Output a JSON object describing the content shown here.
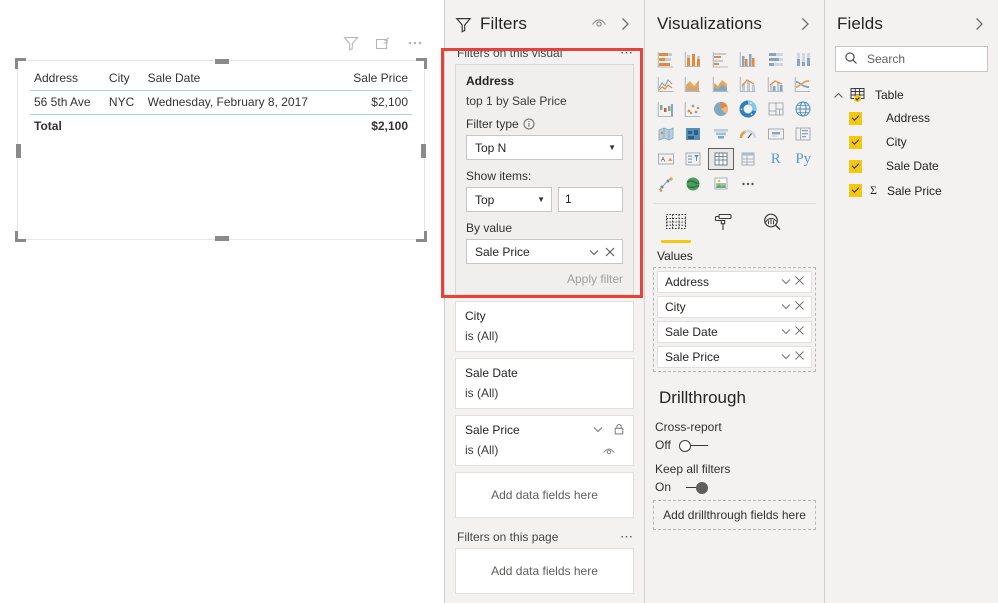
{
  "canvas": {
    "visual_header_icons": [
      "filter-icon",
      "focus-mode-icon",
      "more-options-icon"
    ],
    "table": {
      "columns": [
        "Address",
        "City",
        "Sale Date",
        "Sale Price"
      ],
      "rows": [
        [
          "56 5th Ave",
          "NYC",
          "Wednesday, February 8, 2017",
          "$2,100"
        ]
      ],
      "total_label": "Total",
      "total_value": "$2,100"
    }
  },
  "filters": {
    "title": "Filters",
    "eye_icon": "eye-icon",
    "expand_icon": "chevron-right-icon",
    "visual_section_label": "Filters on this visual",
    "page_section_label": "Filters on this page",
    "more_icon": "ellipsis-icon",
    "active_card": {
      "field": "Address",
      "summary": "top 1 by Sale Price",
      "filter_type_label": "Filter type",
      "info_icon": "info-icon",
      "filter_type_value": "Top N",
      "show_items_label": "Show items:",
      "show_items_direction": "Top",
      "show_items_count": "1",
      "by_value_label": "By value",
      "by_value_field": "Sale Price",
      "apply_label": "Apply filter"
    },
    "cards": [
      {
        "field": "City",
        "value": "is (All)",
        "icons": []
      },
      {
        "field": "Sale Date",
        "value": "is (All)",
        "icons": []
      },
      {
        "field": "Sale Price",
        "value": "is (All)",
        "icons": [
          "chevron-down-icon",
          "lock-icon",
          "eye-icon"
        ]
      }
    ],
    "add_fields_visual": "Add data fields here",
    "add_fields_page": "Add data fields here"
  },
  "visualizations": {
    "title": "Visualizations",
    "expand_icon": "chevron-right-icon",
    "gallery": [
      "stacked-bar-chart-icon",
      "stacked-column-chart-icon",
      "clustered-bar-chart-icon",
      "clustered-column-chart-icon",
      "100-stacked-bar-chart-icon",
      "100-stacked-column-chart-icon",
      "line-chart-icon",
      "area-chart-icon",
      "stacked-area-chart-icon",
      "line-stacked-column-chart-icon",
      "line-clustered-column-chart-icon",
      "ribbon-chart-icon",
      "waterfall-chart-icon",
      "scatter-chart-icon",
      "pie-chart-icon",
      "donut-chart-icon",
      "treemap-icon",
      "map-icon",
      "filled-map-icon",
      "shape-map-icon",
      "funnel-chart-icon",
      "gauge-chart-icon",
      "card-icon",
      "multi-row-card-icon",
      "kpi-icon",
      "slicer-icon",
      "table-icon",
      "matrix-icon",
      "r-script-visual-icon",
      "python-visual-icon",
      "key-influencers-icon",
      "arcgis-map-icon",
      "paginated-report-icon",
      "more-visuals-icon"
    ],
    "selected_visual": "table-icon",
    "tabs": [
      {
        "name": "fields-tab",
        "icon": "fields-icon",
        "active": true
      },
      {
        "name": "format-tab",
        "icon": "paint-roller-icon",
        "active": false
      },
      {
        "name": "analytics-tab",
        "icon": "magnifier-chart-icon",
        "active": false
      }
    ],
    "well_title": "Values",
    "well_items": [
      "Address",
      "City",
      "Sale Date",
      "Sale Price"
    ],
    "drillthrough": {
      "title": "Drillthrough",
      "cross_report_label": "Cross-report",
      "cross_report_state": "Off",
      "keep_all_filters_label": "Keep all filters",
      "keep_all_filters_state": "On",
      "placeholder": "Add drillthrough fields here"
    }
  },
  "fields": {
    "title": "Fields",
    "expand_icon": "chevron-right-icon",
    "search_placeholder": "Search",
    "search_value": "",
    "search_icon": "search-icon",
    "table_name": "Table",
    "items": [
      {
        "label": "Address",
        "checked": true,
        "measure": false
      },
      {
        "label": "City",
        "checked": true,
        "measure": false
      },
      {
        "label": "Sale Date",
        "checked": true,
        "measure": false
      },
      {
        "label": "Sale Price",
        "checked": true,
        "measure": true,
        "sigma": "Σ"
      }
    ]
  },
  "colors": {
    "accent_yellow": "#f2c811",
    "highlight_red": "#e8413a",
    "pane_bg": "#f3f2f1",
    "table_rule": "#a6dcd8"
  }
}
